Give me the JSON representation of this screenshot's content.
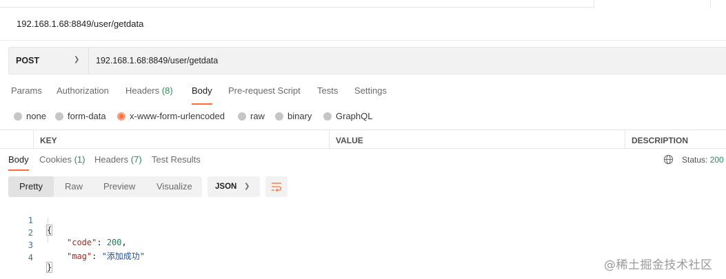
{
  "request": {
    "name": "192.168.1.68:8849/user/getdata",
    "method": "POST",
    "url": "192.168.1.68:8849/user/getdata"
  },
  "request_tabs": [
    {
      "label": "Params",
      "count": ""
    },
    {
      "label": "Authorization",
      "count": ""
    },
    {
      "label": "Headers",
      "count": "(8)"
    },
    {
      "label": "Body",
      "count": ""
    },
    {
      "label": "Pre-request Script",
      "count": ""
    },
    {
      "label": "Tests",
      "count": ""
    },
    {
      "label": "Settings",
      "count": ""
    }
  ],
  "active_request_tab": "Body",
  "body_types": [
    "none",
    "form-data",
    "x-www-form-urlencoded",
    "raw",
    "binary",
    "GraphQL"
  ],
  "selected_body_type": "x-www-form-urlencoded",
  "kv_columns": [
    "KEY",
    "VALUE",
    "DESCRIPTION"
  ],
  "response_tabs": [
    {
      "label": "Body",
      "count": ""
    },
    {
      "label": "Cookies",
      "count": "(1)"
    },
    {
      "label": "Headers",
      "count": "(7)"
    },
    {
      "label": "Test Results",
      "count": ""
    }
  ],
  "active_response_tab": "Body",
  "status": {
    "label": "Status:",
    "code": "200"
  },
  "view_modes": [
    "Pretty",
    "Raw",
    "Preview",
    "Visualize"
  ],
  "active_view_mode": "Pretty",
  "format": "JSON",
  "response_lines": [
    {
      "n": "1",
      "text": "{"
    },
    {
      "n": "2",
      "key": "\"code\"",
      "value": "200",
      "value_type": "number",
      "trail": ","
    },
    {
      "n": "3",
      "key": "\"mag\"",
      "value": "\"添加成功\"",
      "value_type": "string",
      "trail": ""
    },
    {
      "n": "4",
      "text": "}"
    }
  ],
  "watermark": "@稀土掘金技术社区",
  "colors": {
    "accent": "#ff6c37",
    "count": "#2e8b57",
    "key": "#a12a2a",
    "number": "#1a7f5a",
    "string": "#1f4e9a"
  },
  "icons": {
    "status": "globe-icon",
    "wrap": "wrap-lines-icon",
    "dropdown": "chevron-down-icon"
  }
}
